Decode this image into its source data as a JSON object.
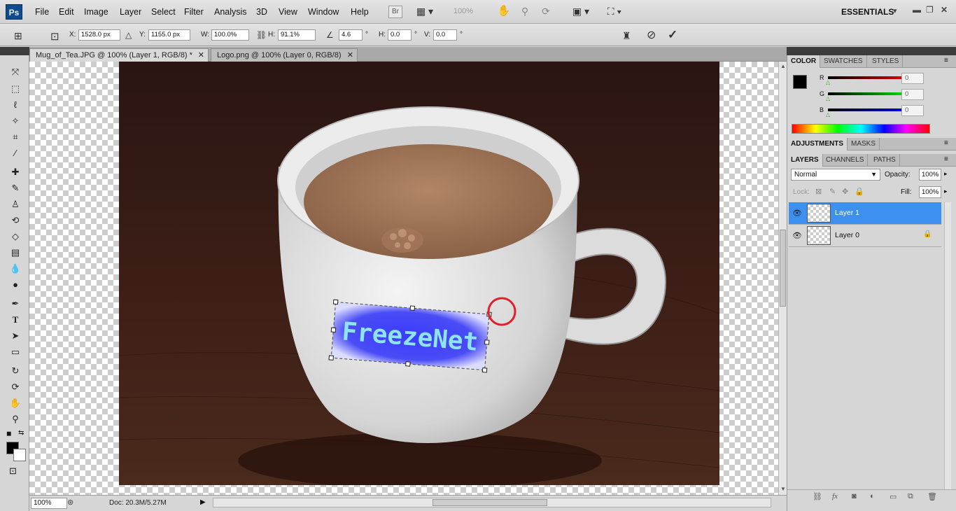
{
  "app": {
    "logo": "Ps",
    "workspace": "ESSENTIALS"
  },
  "menu": [
    "File",
    "Edit",
    "Image",
    "Layer",
    "Select",
    "Filter",
    "Analysis",
    "3D",
    "View",
    "Window",
    "Help"
  ],
  "menubar_widgets": {
    "bridge": "Br",
    "zoom": "100%"
  },
  "options": {
    "x_label": "X:",
    "x_value": "1528.0 px",
    "y_label": "Y:",
    "y_value": "1155.0 px",
    "w_label": "W:",
    "w_value": "100.0%",
    "h_label": "H:",
    "h_value": "91.1%",
    "angle_value": "4.6",
    "hskew_label": "H:",
    "hskew_value": "0.0",
    "vskew_label": "V:",
    "vskew_value": "0.0",
    "degree": "°"
  },
  "tabs": [
    {
      "label": "Mug_of_Tea.JPG @ 100% (Layer 1, RGB/8) *",
      "active": true
    },
    {
      "label": "Logo.png @ 100% (Layer 0, RGB/8)",
      "active": false
    }
  ],
  "canvas": {
    "logo_text": "FreezeNet"
  },
  "status": {
    "zoom": "100%",
    "doc": "Doc: 20.3M/5.27M"
  },
  "panels": {
    "color_tabs": [
      "COLOR",
      "SWATCHES",
      "STYLES"
    ],
    "channels": [
      {
        "label": "R",
        "value": "0",
        "color": "#d40000"
      },
      {
        "label": "G",
        "value": "0",
        "color": "#00b400"
      },
      {
        "label": "B",
        "value": "0",
        "color": "#0000c8"
      }
    ],
    "adjust_tabs": [
      "ADJUSTMENTS",
      "MASKS"
    ],
    "layer_tabs": [
      "LAYERS",
      "CHANNELS",
      "PATHS"
    ],
    "blend_mode": "Normal",
    "opacity_label": "Opacity:",
    "opacity_value": "100%",
    "lock_label": "Lock:",
    "fill_label": "Fill:",
    "fill_value": "100%",
    "layers": [
      {
        "name": "Layer 1",
        "selected": true
      },
      {
        "name": "Layer 0",
        "selected": false
      }
    ]
  },
  "colors": {
    "selection": "#3d8ff0",
    "brand": "#0f4b8f",
    "annotation_circle": "#e0202a"
  }
}
